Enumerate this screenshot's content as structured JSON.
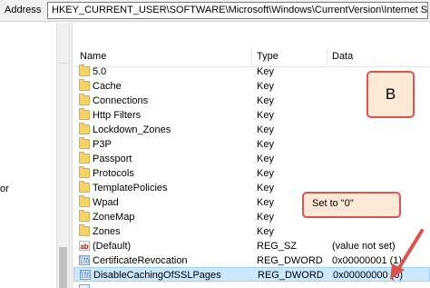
{
  "address_bar": {
    "label": "Address",
    "path": "HKEY_CURRENT_USER\\SOFTWARE\\Microsoft\\Windows\\CurrentVersion\\Internet Settings"
  },
  "tree": {
    "partial_text": "or"
  },
  "columns": {
    "name": "Name",
    "type": "Type",
    "data": "Data"
  },
  "rows": [
    {
      "name": "5.0",
      "type": "Key",
      "data": "",
      "icon": "folder-icon"
    },
    {
      "name": "Cache",
      "type": "Key",
      "data": "",
      "icon": "folder-icon"
    },
    {
      "name": "Connections",
      "type": "Key",
      "data": "",
      "icon": "folder-icon"
    },
    {
      "name": "Http Filters",
      "type": "Key",
      "data": "",
      "icon": "folder-icon"
    },
    {
      "name": "Lockdown_Zones",
      "type": "Key",
      "data": "",
      "icon": "folder-icon"
    },
    {
      "name": "P3P",
      "type": "Key",
      "data": "",
      "icon": "folder-icon"
    },
    {
      "name": "Passport",
      "type": "Key",
      "data": "",
      "icon": "folder-icon"
    },
    {
      "name": "Protocols",
      "type": "Key",
      "data": "",
      "icon": "folder-icon"
    },
    {
      "name": "TemplatePolicies",
      "type": "Key",
      "data": "",
      "icon": "folder-icon"
    },
    {
      "name": "Wpad",
      "type": "Key",
      "data": "",
      "icon": "folder-icon"
    },
    {
      "name": "ZoneMap",
      "type": "Key",
      "data": "",
      "icon": "folder-icon"
    },
    {
      "name": "Zones",
      "type": "Key",
      "data": "",
      "icon": "folder-icon"
    },
    {
      "name": "(Default)",
      "type": "REG_SZ",
      "data": "(value not set)",
      "icon": "string-value-icon"
    },
    {
      "name": "CertificateRevocation",
      "type": "REG_DWORD",
      "data": "0x00000001 (1)",
      "icon": "binary-value-icon"
    },
    {
      "name": "DisableCachingOfSSLPages",
      "type": "REG_DWORD",
      "data": "0x00000000 (0)",
      "icon": "binary-value-icon",
      "selected": true
    }
  ],
  "annotations": {
    "label_b": "B",
    "set_to": "Set to \"0\""
  },
  "colors": {
    "selection": "#cce8ff",
    "callout_border": "#d9534f",
    "callout_fill": "#fde9d6",
    "folder": "#f6d36b"
  }
}
